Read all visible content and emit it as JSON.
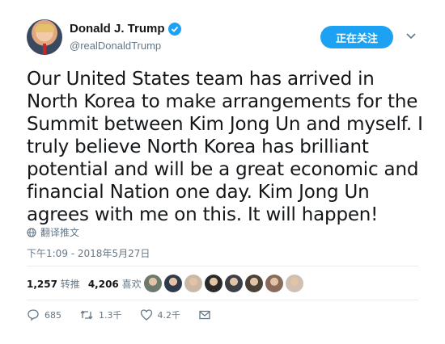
{
  "user": {
    "display_name": "Donald J. Trump",
    "handle": "@realDonaldTrump",
    "verified": true
  },
  "follow_button": {
    "label": "正在关注"
  },
  "tweet": {
    "text": "Our United States team has arrived in North Korea to make arrangements for the Summit between Kim Jong Un and myself. I truly believe North Korea has brilliant potential and will be a great economic and financial Nation one day. Kim Jong Un agrees with me on this. It will happen!",
    "translate_label": "翻译推文",
    "timestamp": "下午1:09 - 2018年5月27日"
  },
  "stats": {
    "retweets_count": "1,257",
    "retweets_label": "转推",
    "likes_count": "4,206",
    "likes_label": "喜欢"
  },
  "likers": [
    {
      "name": "liker-1",
      "color": "#6b7a6d"
    },
    {
      "name": "liker-2",
      "color": "#2f3b4d"
    },
    {
      "name": "liker-3",
      "color": "#c9b8a6"
    },
    {
      "name": "liker-4",
      "color": "#2a2a2a"
    },
    {
      "name": "liker-5",
      "color": "#3c3f46"
    },
    {
      "name": "liker-6",
      "color": "#4a4238"
    },
    {
      "name": "liker-7",
      "color": "#8a6a58"
    },
    {
      "name": "liker-8",
      "color": "#d0bfb3"
    }
  ],
  "actions": {
    "replies": "685",
    "retweets": "1.3千",
    "likes": "4.2千"
  },
  "colors": {
    "accent": "#1da1f2",
    "secondary_text": "#657786",
    "divider": "#e6ecf0"
  }
}
